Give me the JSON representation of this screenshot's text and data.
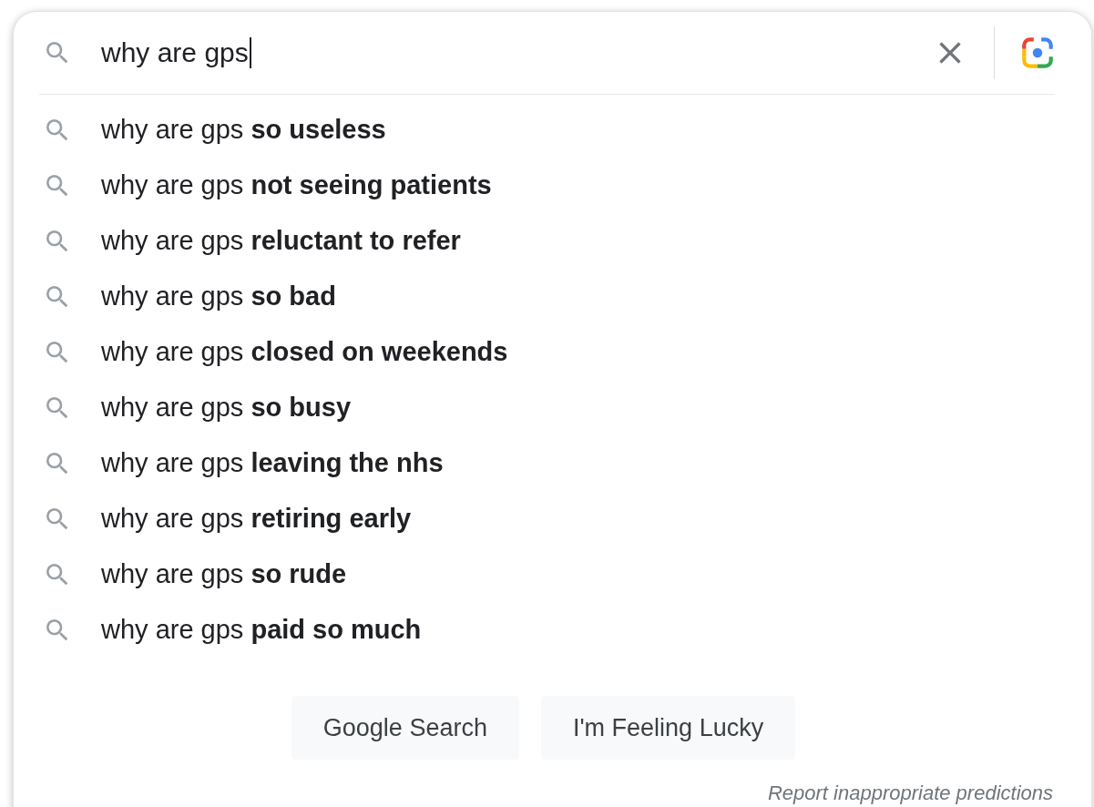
{
  "search": {
    "value": "why are gps"
  },
  "suggestions": [
    {
      "text": "why are gps **so useless**"
    },
    {
      "text": "why are gps **not seeing patients**"
    },
    {
      "text": "why are gps **reluctant to refer**"
    },
    {
      "text": "why are gps **so bad**"
    },
    {
      "text": "why are gps **closed on weekends**"
    },
    {
      "text": "why are gps **so busy**"
    },
    {
      "text": "why are gps **leaving the nhs**"
    },
    {
      "text": "why are gps **retiring early**"
    },
    {
      "text": "why are gps **so rude**"
    },
    {
      "text": "why are gps **paid so much**"
    }
  ],
  "buttons": [
    "Google Search",
    "I'm Feeling Lucky"
  ],
  "report_link": "Report inappropriate predictions"
}
